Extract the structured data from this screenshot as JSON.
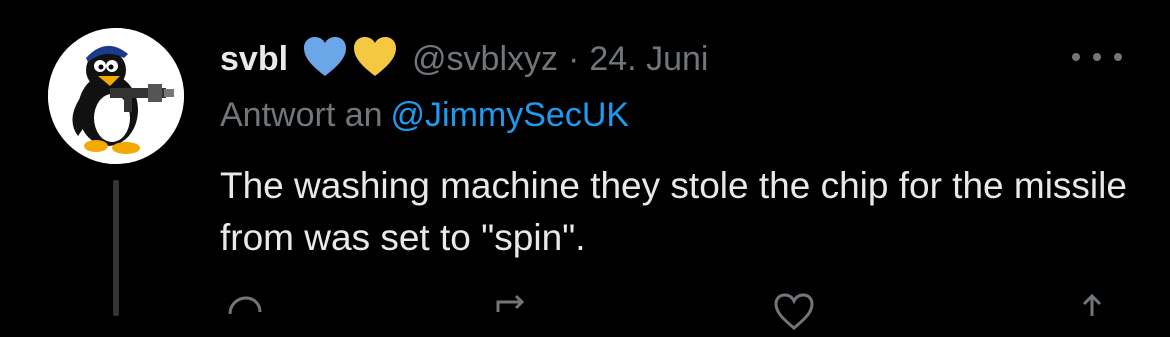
{
  "tweet": {
    "display_name": "svbl",
    "handle": "@svblxyz",
    "separator": "·",
    "date": "24. Juni",
    "reply_prefix": "Antwort an",
    "reply_to": "@JimmySecUK",
    "text": "The washing machine they stole the chip for the missile from was set to \"spin\".",
    "badges": [
      "blue-heart-icon",
      "yellow-heart-icon"
    ]
  },
  "colors": {
    "background": "#000000",
    "primary_text": "#e7e9ea",
    "secondary_text": "#71767b",
    "link": "#1d9bf0",
    "blue_heart": "#6aa6e8",
    "yellow_heart": "#f5c842"
  },
  "actions": [
    "reply-icon",
    "retweet-icon",
    "like-icon",
    "share-icon"
  ]
}
